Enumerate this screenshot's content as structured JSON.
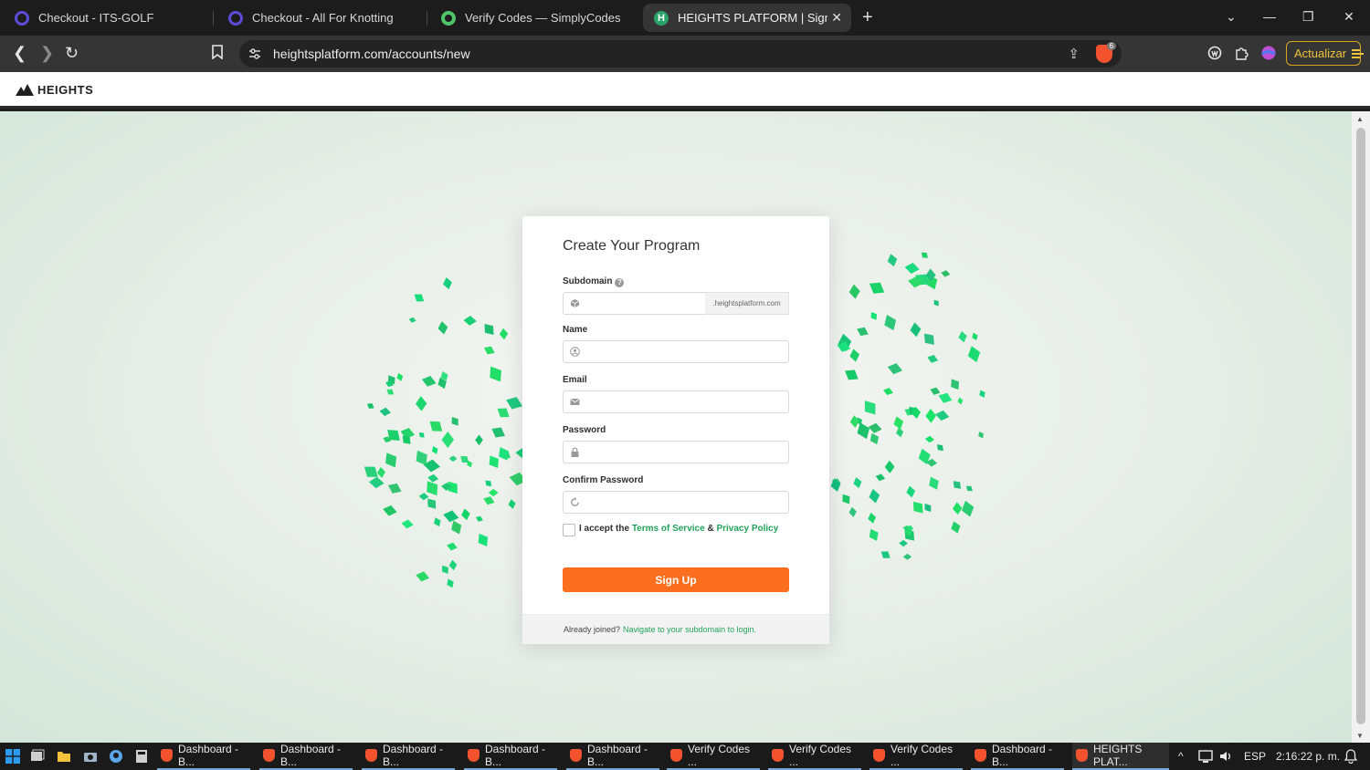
{
  "browser": {
    "tabs": [
      {
        "label": "Checkout - ITS-GOLF",
        "icon": "checkout-ring-icon"
      },
      {
        "label": "Checkout - All For Knotting",
        "icon": "checkout-ring-icon"
      },
      {
        "label": "Verify Codes — SimplyCodes",
        "icon": "simplycodes-icon"
      },
      {
        "label": "HEIGHTS PLATFORM | Sign Up",
        "icon": "heights-h-icon",
        "active": true
      }
    ],
    "new_tab": "+",
    "url": "heightsplatform.com/accounts/new",
    "brave_badge": "6",
    "update_label": "Actualizar"
  },
  "site": {
    "brand": "HEIGHTS"
  },
  "form": {
    "title": "Create Your Program",
    "subdomain_label": "Subdomain",
    "help_mark": "?",
    "subdomain_suffix": ".heightsplatform.com",
    "name_label": "Name",
    "email_label": "Email",
    "password_label": "Password",
    "confirm_label": "Confirm Password",
    "terms_prefix": "I accept the",
    "terms_link": "Terms of Service",
    "terms_amp": "&",
    "privacy_link": "Privacy Policy",
    "submit_label": "Sign Up",
    "footer_text": "Already joined?",
    "footer_link": "Navigate to your subdomain to login.",
    "accent_color": "#22a35a",
    "button_color": "#fa6e1e"
  },
  "taskbar": {
    "items": [
      {
        "label": "Dashboard - B..."
      },
      {
        "label": "Dashboard - B..."
      },
      {
        "label": "Dashboard - B..."
      },
      {
        "label": "Dashboard - B..."
      },
      {
        "label": "Dashboard - B..."
      },
      {
        "label": "Verify Codes ..."
      },
      {
        "label": "Verify Codes ..."
      },
      {
        "label": "Verify Codes ..."
      },
      {
        "label": "Dashboard - B..."
      },
      {
        "label": "HEIGHTS PLAT...",
        "active": true
      }
    ],
    "language": "ESP",
    "clock": "2:16:22 p. m."
  }
}
